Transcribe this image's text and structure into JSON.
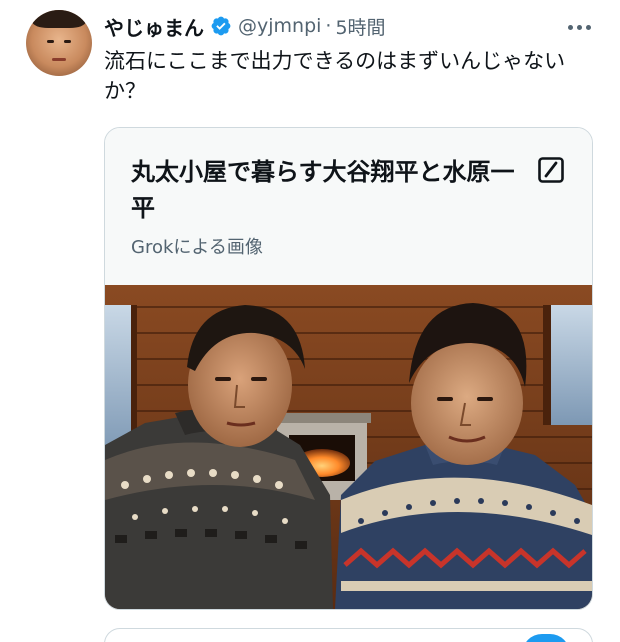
{
  "author": {
    "display_name": "やじゅまん",
    "handle": "@yjmnpi",
    "separator": "·",
    "time": "5時間",
    "verified_icon": "verified-badge-icon",
    "verified_color": "#1d9bf0"
  },
  "tweet": {
    "text": "流石にここまで出力できるのはまずいんじゃないか？"
  },
  "card": {
    "title": "丸太小屋で暮らす大谷翔平と水原一平",
    "subtitle": "Grokによる画像",
    "edit_icon": "edit-icon"
  },
  "icons": {
    "more": "more-icon"
  },
  "colors": {
    "text_primary": "#0f1419",
    "text_secondary": "#536471",
    "accent": "#1d9bf0",
    "card_bg": "#f7f9f9",
    "border": "#cfd9de"
  }
}
